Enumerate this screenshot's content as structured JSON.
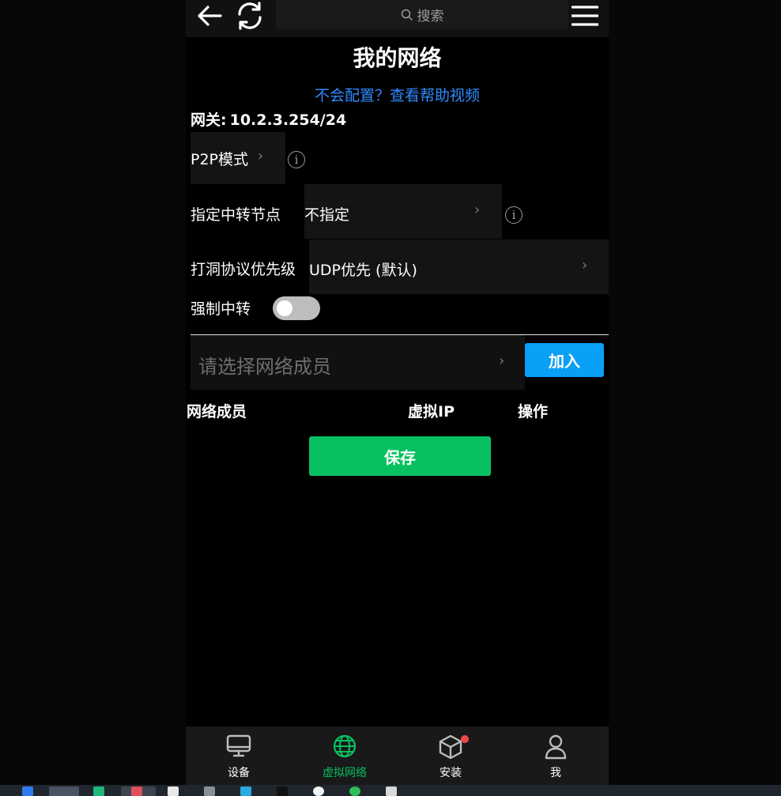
{
  "header": {
    "search_placeholder": "搜索",
    "back_icon": "back-arrow-icon",
    "refresh_icon": "refresh-icon",
    "menu_icon": "hamburger-menu-icon"
  },
  "page": {
    "title": "我的网络",
    "help_link": "不会配置？查看帮助视频"
  },
  "gateway": {
    "label": "网关:",
    "value": "10.2.3.254/24"
  },
  "settings": {
    "p2p_mode_label": "P2P模式",
    "relay_node_label": "指定中转节点",
    "relay_node_value": "不指定",
    "hole_punch_label": "打洞协议优先级",
    "hole_punch_value": "UDP优先 (默认)",
    "force_relay_label": "强制中转",
    "force_relay_on": false
  },
  "members": {
    "select_placeholder": "请选择网络成员",
    "join_button": "加入",
    "columns": [
      "网络成员",
      "虚拟IP",
      "操作"
    ],
    "rows": []
  },
  "save_button": "保存",
  "tabs": [
    {
      "label": "设备",
      "icon": "monitor-icon",
      "active": false
    },
    {
      "label": "虚拟网络",
      "icon": "globe-icon",
      "active": true
    },
    {
      "label": "安装",
      "icon": "package-box-icon",
      "active": false,
      "badge": true
    },
    {
      "label": "我",
      "icon": "user-icon",
      "active": false
    }
  ],
  "colors": {
    "accent_green": "#07c160",
    "link_blue": "#2f8bff",
    "join_blue": "#0aa0f5",
    "badge_red": "#f04848",
    "background": "#000000"
  }
}
